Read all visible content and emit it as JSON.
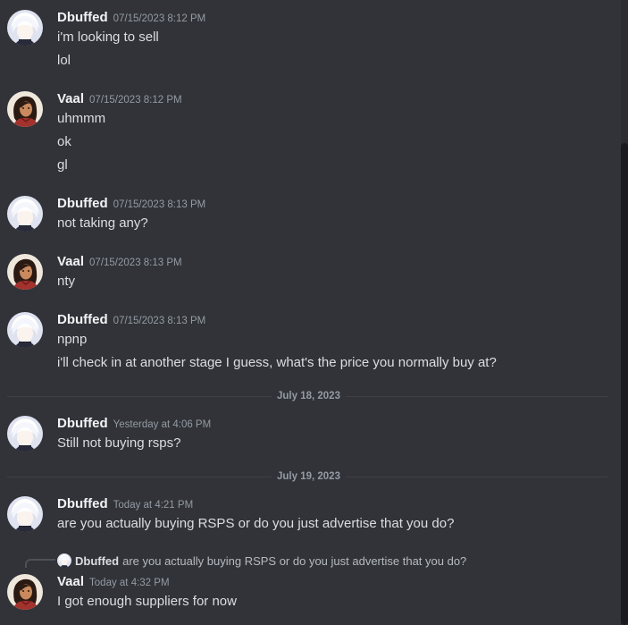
{
  "messages": [
    {
      "user": "Dbuffed",
      "time": "07/15/2023 8:12 PM",
      "lines": [
        "i'm looking to sell",
        "lol"
      ]
    },
    {
      "user": "Vaal",
      "time": "07/15/2023 8:12 PM",
      "lines": [
        "uhmmm",
        "ok",
        "gl"
      ]
    },
    {
      "user": "Dbuffed",
      "time": "07/15/2023 8:13 PM",
      "lines": [
        "not taking any?"
      ]
    },
    {
      "user": "Vaal",
      "time": "07/15/2023 8:13 PM",
      "lines": [
        "nty"
      ]
    },
    {
      "user": "Dbuffed",
      "time": "07/15/2023 8:13 PM",
      "lines": [
        "npnp",
        "i'll check in at another stage I guess, what's the price you normally buy at?"
      ]
    },
    {
      "user": "Dbuffed",
      "time": "Yesterday at 4:06 PM",
      "lines": [
        "Still not buying rsps?"
      ]
    },
    {
      "user": "Dbuffed",
      "time": "Today at 4:21 PM",
      "lines": [
        "are you actually buying RSPS or do you just advertise that you do?"
      ]
    },
    {
      "user": "Vaal",
      "time": "Today at 4:32 PM",
      "lines": [
        "I got enough suppliers for now"
      ]
    }
  ],
  "dividers": [
    "July 18, 2023",
    "July 19, 2023"
  ],
  "reply": {
    "user": "Dbuffed",
    "text": "are you actually buying RSPS or do you just advertise that you do?"
  },
  "colors": {
    "background": "#313338",
    "username": "#f2f3f5",
    "text": "#dbdee1",
    "muted": "#949ba4"
  },
  "icons": {
    "dbuffed_avatar": "white-haired-character-avatar",
    "vaal_avatar": "dark-haired-character-avatar"
  }
}
